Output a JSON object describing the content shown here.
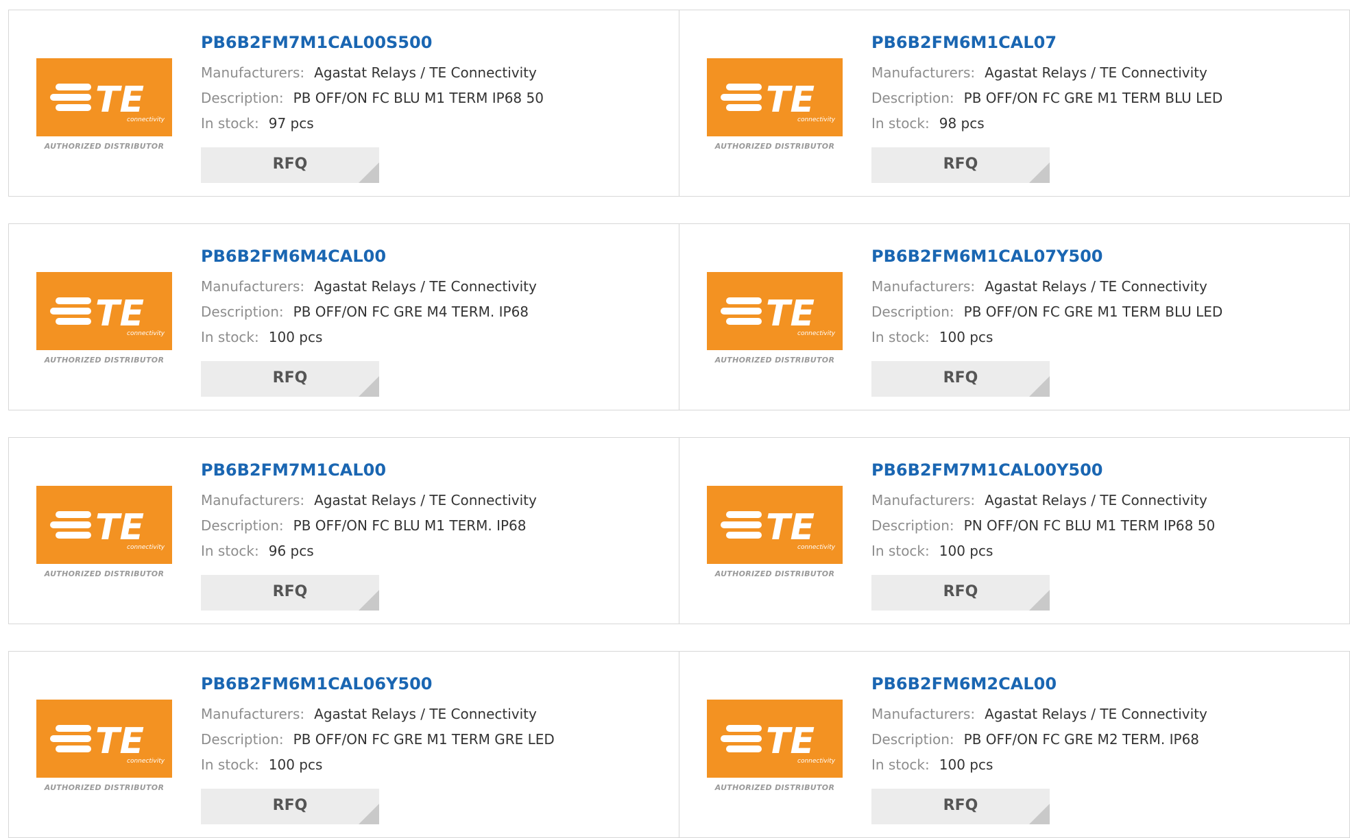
{
  "logo": {
    "brand": "TE",
    "brand_sub": "connectivity",
    "caption": "AUTHORIZED DISTRIBUTOR",
    "color": "#f39222"
  },
  "labels": {
    "manufacturers": "Manufacturers:",
    "description": "Description:",
    "in_stock": "In stock:",
    "rfq": "RFQ"
  },
  "colors": {
    "part_number": "#1a66b2",
    "label": "#8d8d8d",
    "value": "#333333"
  },
  "products": [
    {
      "part_number": "PB6B2FM7M1CAL00S500",
      "manufacturer": "Agastat Relays / TE Connectivity",
      "description": "PB OFF/ON FC BLU M1 TERM IP68 50",
      "stock": "97 pcs"
    },
    {
      "part_number": "PB6B2FM6M1CAL07",
      "manufacturer": "Agastat Relays / TE Connectivity",
      "description": "PB OFF/ON FC GRE M1 TERM BLU LED",
      "stock": "98 pcs"
    },
    {
      "part_number": "PB6B2FM6M4CAL00",
      "manufacturer": "Agastat Relays / TE Connectivity",
      "description": "PB OFF/ON FC GRE M4 TERM. IP68",
      "stock": "100 pcs"
    },
    {
      "part_number": "PB6B2FM6M1CAL07Y500",
      "manufacturer": "Agastat Relays / TE Connectivity",
      "description": "PB OFF/ON FC GRE M1 TERM BLU LED",
      "stock": "100 pcs"
    },
    {
      "part_number": "PB6B2FM7M1CAL00",
      "manufacturer": "Agastat Relays / TE Connectivity",
      "description": "PB OFF/ON FC BLU M1 TERM. IP68",
      "stock": "96 pcs"
    },
    {
      "part_number": "PB6B2FM7M1CAL00Y500",
      "manufacturer": "Agastat Relays / TE Connectivity",
      "description": "PN OFF/ON FC BLU M1 TERM IP68 50",
      "stock": "100 pcs"
    },
    {
      "part_number": "PB6B2FM6M1CAL06Y500",
      "manufacturer": "Agastat Relays / TE Connectivity",
      "description": "PB OFF/ON FC GRE M1 TERM GRE LED",
      "stock": "100 pcs"
    },
    {
      "part_number": "PB6B2FM6M2CAL00",
      "manufacturer": "Agastat Relays / TE Connectivity",
      "description": "PB OFF/ON FC GRE M2 TERM. IP68",
      "stock": "100 pcs"
    }
  ]
}
